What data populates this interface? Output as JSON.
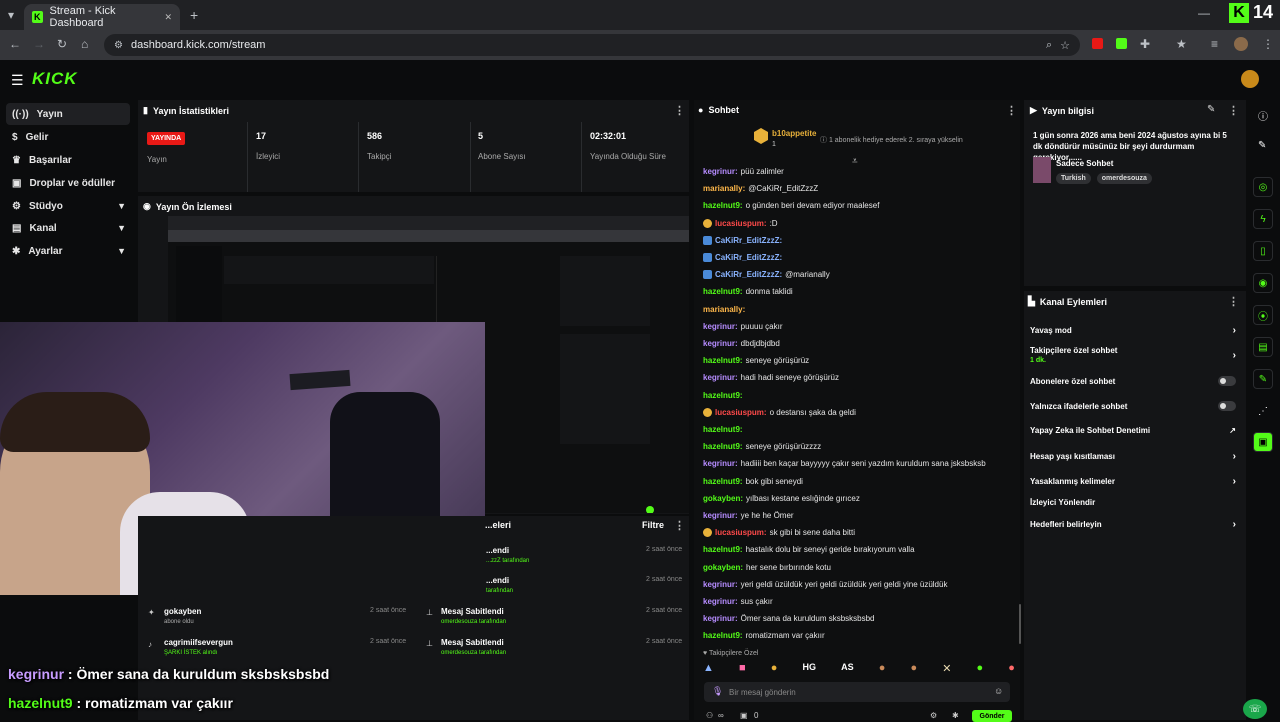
{
  "browser": {
    "tab_title": "Stream - Kick Dashboard",
    "url": "dashboard.kick.com/stream",
    "new_tab": "+",
    "close_tab": "✕"
  },
  "overlay": {
    "k_logo": "K",
    "viewer_count": "14"
  },
  "kick": {
    "logo": "KICK"
  },
  "sidebar": {
    "items": [
      {
        "label": "Yayın"
      },
      {
        "label": "Gelir"
      },
      {
        "label": "Başarılar"
      },
      {
        "label": "Droplar ve ödüller"
      },
      {
        "label": "Stüdyo"
      },
      {
        "label": "Kanal"
      },
      {
        "label": "Ayarlar"
      }
    ]
  },
  "stats": {
    "title": "Yayın İstatistikleri",
    "live_badge": "YAYINDA",
    "live_label": "Yayın",
    "viewers_value": "17",
    "viewers_label": "İzleyici",
    "followers_value": "586",
    "followers_label": "Takipçi",
    "subs_value": "5",
    "subs_label": "Abone Sayısı",
    "uptime_value": "02:32:01",
    "uptime_label": "Yayında Olduğu Süre"
  },
  "preview": {
    "title": "Yayın Ön İzlemesi"
  },
  "activity": {
    "title": "...eleri",
    "filter": "Filtre",
    "rows": [
      {
        "user": "gokayben",
        "action": "abone oldu",
        "time": "2 saat önce"
      },
      {
        "user": "cagrimiifsevergun",
        "action": "ŞARKI İSTEK alındı",
        "time": "2 saat önce"
      }
    ],
    "right_rows": [
      {
        "title": "...endi",
        "by": "...zzZ tarafından",
        "time": "2 saat önce"
      },
      {
        "title": "...endi",
        "by": "tarafından",
        "time": "2 saat önce"
      },
      {
        "title": "Mesaj Sabitlendi",
        "by": "omerdesouza tarafından",
        "time": "2 saat önce"
      },
      {
        "title": "Mesaj Sabitlendi",
        "by": "omerdesouza tarafından",
        "time": "2 saat önce"
      }
    ]
  },
  "chat": {
    "title": "Sohbet",
    "pinned_user": "b10appetite",
    "pinned_count": "1",
    "pinned_text": "1 abonelik hediye ederek 2. sıraya yükselin",
    "followers_only_label": "Takipçilere Özel",
    "input_placeholder": "Bir mesaj gönderin",
    "send_label": "Gönder",
    "footer_count": "0",
    "messages": [
      {
        "user": "kegrinur",
        "color": "#b68cff",
        "text": "püü zalimler"
      },
      {
        "user": "marianally",
        "color": "#ffb84a",
        "text": "@CaKiRr_EditZzzZ"
      },
      {
        "user": "hazelnut9",
        "color": "#53fc18",
        "text": "o günden beri devam ediyor maalesef"
      },
      {
        "user": "lucasiuspum",
        "color": "#ff4a4a",
        "text": ":D"
      },
      {
        "user": "CaKiRr_EditZzzZ",
        "color": "#8ab4ff",
        "text": ""
      },
      {
        "user": "CaKiRr_EditZzzZ",
        "color": "#8ab4ff",
        "text": ""
      },
      {
        "user": "CaKiRr_EditZzzZ",
        "color": "#8ab4ff",
        "text": "@marianally"
      },
      {
        "user": "hazelnut9",
        "color": "#53fc18",
        "text": "donma taklidi"
      },
      {
        "user": "marianally",
        "color": "#ffb84a",
        "text": ""
      },
      {
        "user": "kegrinur",
        "color": "#b68cff",
        "text": "puuuu çakır"
      },
      {
        "user": "kegrinur",
        "color": "#b68cff",
        "text": "dbdjdbjdbd"
      },
      {
        "user": "hazelnut9",
        "color": "#53fc18",
        "text": "seneye görüşürüz"
      },
      {
        "user": "kegrinur",
        "color": "#b68cff",
        "text": "hadi hadi seneye görüşürüz"
      },
      {
        "user": "hazelnut9",
        "color": "#53fc18",
        "text": ""
      },
      {
        "user": "lucasiuspum",
        "color": "#ff4a4a",
        "text": "o destansı şaka da geldi"
      },
      {
        "user": "hazelnut9",
        "color": "#53fc18",
        "text": ""
      },
      {
        "user": "hazelnut9",
        "color": "#53fc18",
        "text": "seneye görüşürüzzzz"
      },
      {
        "user": "kegrinur",
        "color": "#b68cff",
        "text": "hadiiii ben kaçar bayyyyy çakır seni yazdım kuruldum sana jsksbsksb"
      },
      {
        "user": "hazelnut9",
        "color": "#53fc18",
        "text": "bok gibi seneydi"
      },
      {
        "user": "gokayben",
        "color": "#53fc18",
        "text": "yılbası kestane eslığinde gırıcez"
      },
      {
        "user": "kegrinur",
        "color": "#b68cff",
        "text": "ye he he Ömer"
      },
      {
        "user": "lucasiuspum",
        "color": "#ff4a4a",
        "text": "sk gibi bi sene daha bitti"
      },
      {
        "user": "hazelnut9",
        "color": "#53fc18",
        "text": "hastalık dolu bir seneyi geride bırakıyorum valla"
      },
      {
        "user": "gokayben",
        "color": "#53fc18",
        "text": "her sene bırbırınde kotu"
      },
      {
        "user": "kegrinur",
        "color": "#b68cff",
        "text": "yeri geldi üzüldük yeri geldi üzüldük yeri geldi yine üzüldük"
      },
      {
        "user": "kegrinur",
        "color": "#b68cff",
        "text": "sus çakır"
      },
      {
        "user": "kegrinur",
        "color": "#b68cff",
        "text": "Ömer sana da kuruldum sksbsksbsbd"
      },
      {
        "user": "hazelnut9",
        "color": "#53fc18",
        "text": "romatizmam var çakıır"
      }
    ]
  },
  "stream_info": {
    "title": "Yayın bilgisi",
    "description": "1 gün sonra 2026 ama beni 2024 ağustos ayına bi 5 dk döndürür müsünüz bir şeyi durdurmam gerekiyor......",
    "category": "Sadece Sohbet",
    "tags": [
      "Turkish",
      "omerdesouza"
    ]
  },
  "channel_actions": {
    "title": "Kanal Eylemleri",
    "items": [
      {
        "label": "Yavaş mod"
      },
      {
        "label": "Takipçilere özel sohbet",
        "sub": "1 dk."
      },
      {
        "label": "Abonelere özel sohbet"
      },
      {
        "label": "Yalnızca ifadelerle sohbet"
      },
      {
        "label": "Yapay Zeka ile Sohbet Denetimi"
      },
      {
        "label": "Hesap yaşı kısıtlaması"
      },
      {
        "label": "Yasaklanmış kelimeler"
      },
      {
        "label": "İzleyici Yönlendir"
      },
      {
        "label": "Hedefleri belirleyin"
      }
    ]
  },
  "captions": [
    {
      "user": "kegrinur",
      "sep": " : ",
      "text": "Ömer sana da kuruldum sksbsksbsbd"
    },
    {
      "user": "hazelnut9",
      "sep": " : ",
      "text": "romatizmam var çakıır"
    }
  ],
  "colors": {
    "accent": "#53fc18",
    "live": "#e91916",
    "panel": "#141517"
  }
}
